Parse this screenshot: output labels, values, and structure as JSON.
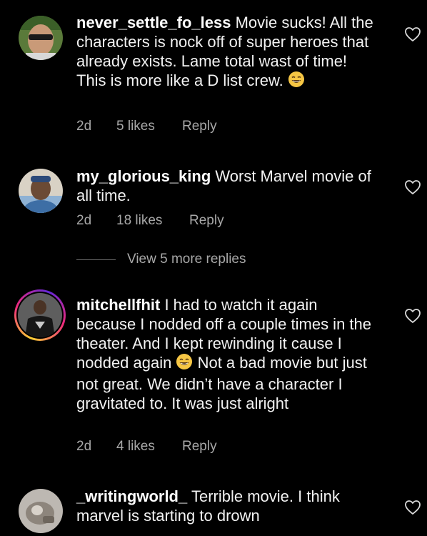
{
  "comments": [
    {
      "username": "never_settle_fo_less",
      "text": " Movie sucks! All the characters is nock off of super heroes that already exists. Lame total wast of time! This is more like a D list crew. ",
      "emoji": "grinning-sweat-emoji",
      "time": "2d",
      "likes": "5 likes",
      "reply": "Reply"
    },
    {
      "username": "my_glorious_king",
      "text": " Worst Marvel movie of all time.",
      "time": "2d",
      "likes": "18 likes",
      "reply": "Reply"
    },
    {
      "username": "mitchellfhit",
      "text_part1": " I had to watch it again because I nodded off a couple times in the theater. And I kept rewinding it cause I nodded again ",
      "text_part2": " Not a bad movie but just not great. We didn’t have a character I gravitated to. It was just alright",
      "time": "2d",
      "likes": "4 likes",
      "reply": "Reply"
    },
    {
      "username": "_writingworld_",
      "text": " Terrible movie. I think marvel is starting to drown"
    }
  ],
  "view_more": {
    "label": "View 5 more replies"
  },
  "icons": {
    "like": "heart-outline-icon"
  },
  "colors": {
    "background": "#000000",
    "text": "#f2f2f2",
    "meta": "#a8a8a8"
  }
}
